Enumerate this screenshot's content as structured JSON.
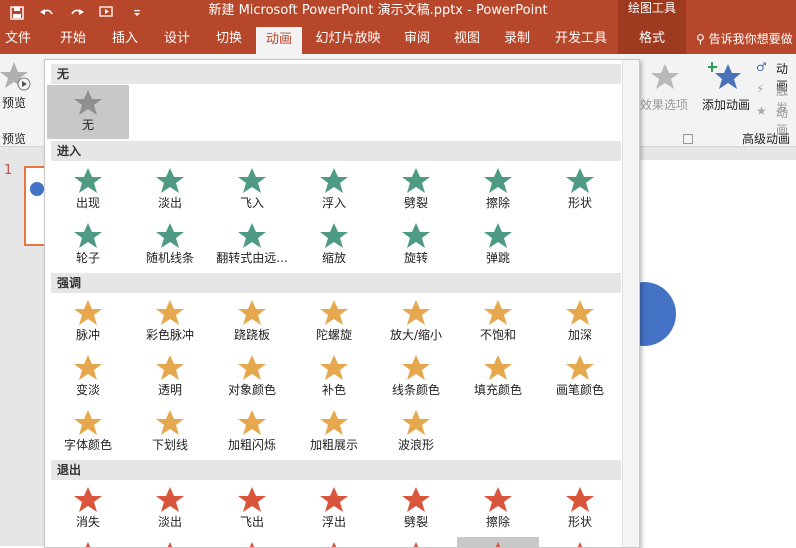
{
  "window": {
    "title": "新建 Microsoft PowerPoint 演示文稿.pptx  -  PowerPoint",
    "contextual_group": "绘图工具"
  },
  "tabs": [
    "文件",
    "开始",
    "插入",
    "设计",
    "切换",
    "动画",
    "幻灯片放映",
    "审阅",
    "视图",
    "录制",
    "开发工具",
    "格式"
  ],
  "active_tab": "动画",
  "tell_me": "告诉我你想要做",
  "ribbon": {
    "preview_label": "预览",
    "preview_group": "预览",
    "effect_options": "效果选项",
    "add_animation": "添加动画",
    "advanced_group": "高级动画",
    "animation_pane": "动画",
    "trigger": "触发",
    "animation_painter": "动画"
  },
  "slide": {
    "number": "1"
  },
  "colors": {
    "brand": "#b7472a",
    "entrance": "#4e9a84",
    "emphasis": "#e6a84e",
    "exit": "#d9553b"
  },
  "gallery": {
    "none_header": "无",
    "none_item": "无",
    "entrance_header": "进入",
    "entrance": [
      "出现",
      "淡出",
      "飞入",
      "浮入",
      "劈裂",
      "擦除",
      "形状",
      "轮子",
      "随机线条",
      "翻转式由远...",
      "缩放",
      "旋转",
      "弹跳"
    ],
    "emphasis_header": "强调",
    "emphasis": [
      "脉冲",
      "彩色脉冲",
      "跷跷板",
      "陀螺旋",
      "放大/缩小",
      "不饱和",
      "加深",
      "变淡",
      "透明",
      "对象颜色",
      "补色",
      "线条颜色",
      "填充颜色",
      "画笔颜色",
      "字体颜色",
      "下划线",
      "加粗闪烁",
      "加粗展示",
      "波浪形"
    ],
    "exit_header": "退出",
    "exit": [
      "消失",
      "淡出",
      "飞出",
      "浮出",
      "劈裂",
      "擦除",
      "形状"
    ],
    "selected_item": "无"
  }
}
